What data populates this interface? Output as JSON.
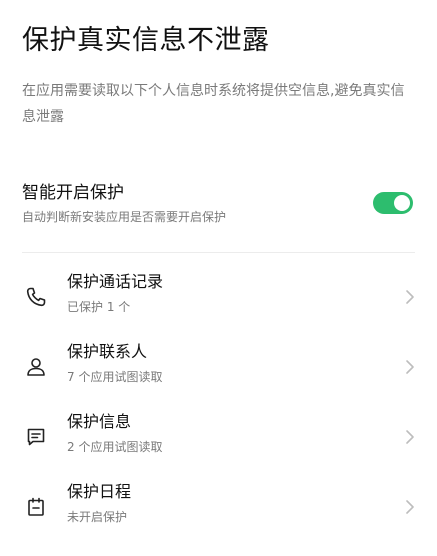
{
  "page": {
    "title": "保护真实信息不泄露",
    "description": "在应用需要读取以下个人信息时系统将提供空信息,避免真实信息泄露"
  },
  "smart_protect": {
    "title": "智能开启保护",
    "subtitle": "自动判断新安装应用是否需要开启保护",
    "enabled": true,
    "toggle_color": "#2dbd6e"
  },
  "items": [
    {
      "icon": "phone-icon",
      "title": "保护通话记录",
      "subtitle": "已保护 1 个"
    },
    {
      "icon": "contact-person-icon",
      "title": "保护联系人",
      "subtitle": "7 个应用试图读取"
    },
    {
      "icon": "message-icon",
      "title": "保护信息",
      "subtitle": "2 个应用试图读取"
    },
    {
      "icon": "calendar-icon",
      "title": "保护日程",
      "subtitle": "未开启保护"
    }
  ],
  "colors": {
    "text_primary": "#111111",
    "text_secondary": "#7a7a7a",
    "chevron": "#bdbdbd"
  }
}
